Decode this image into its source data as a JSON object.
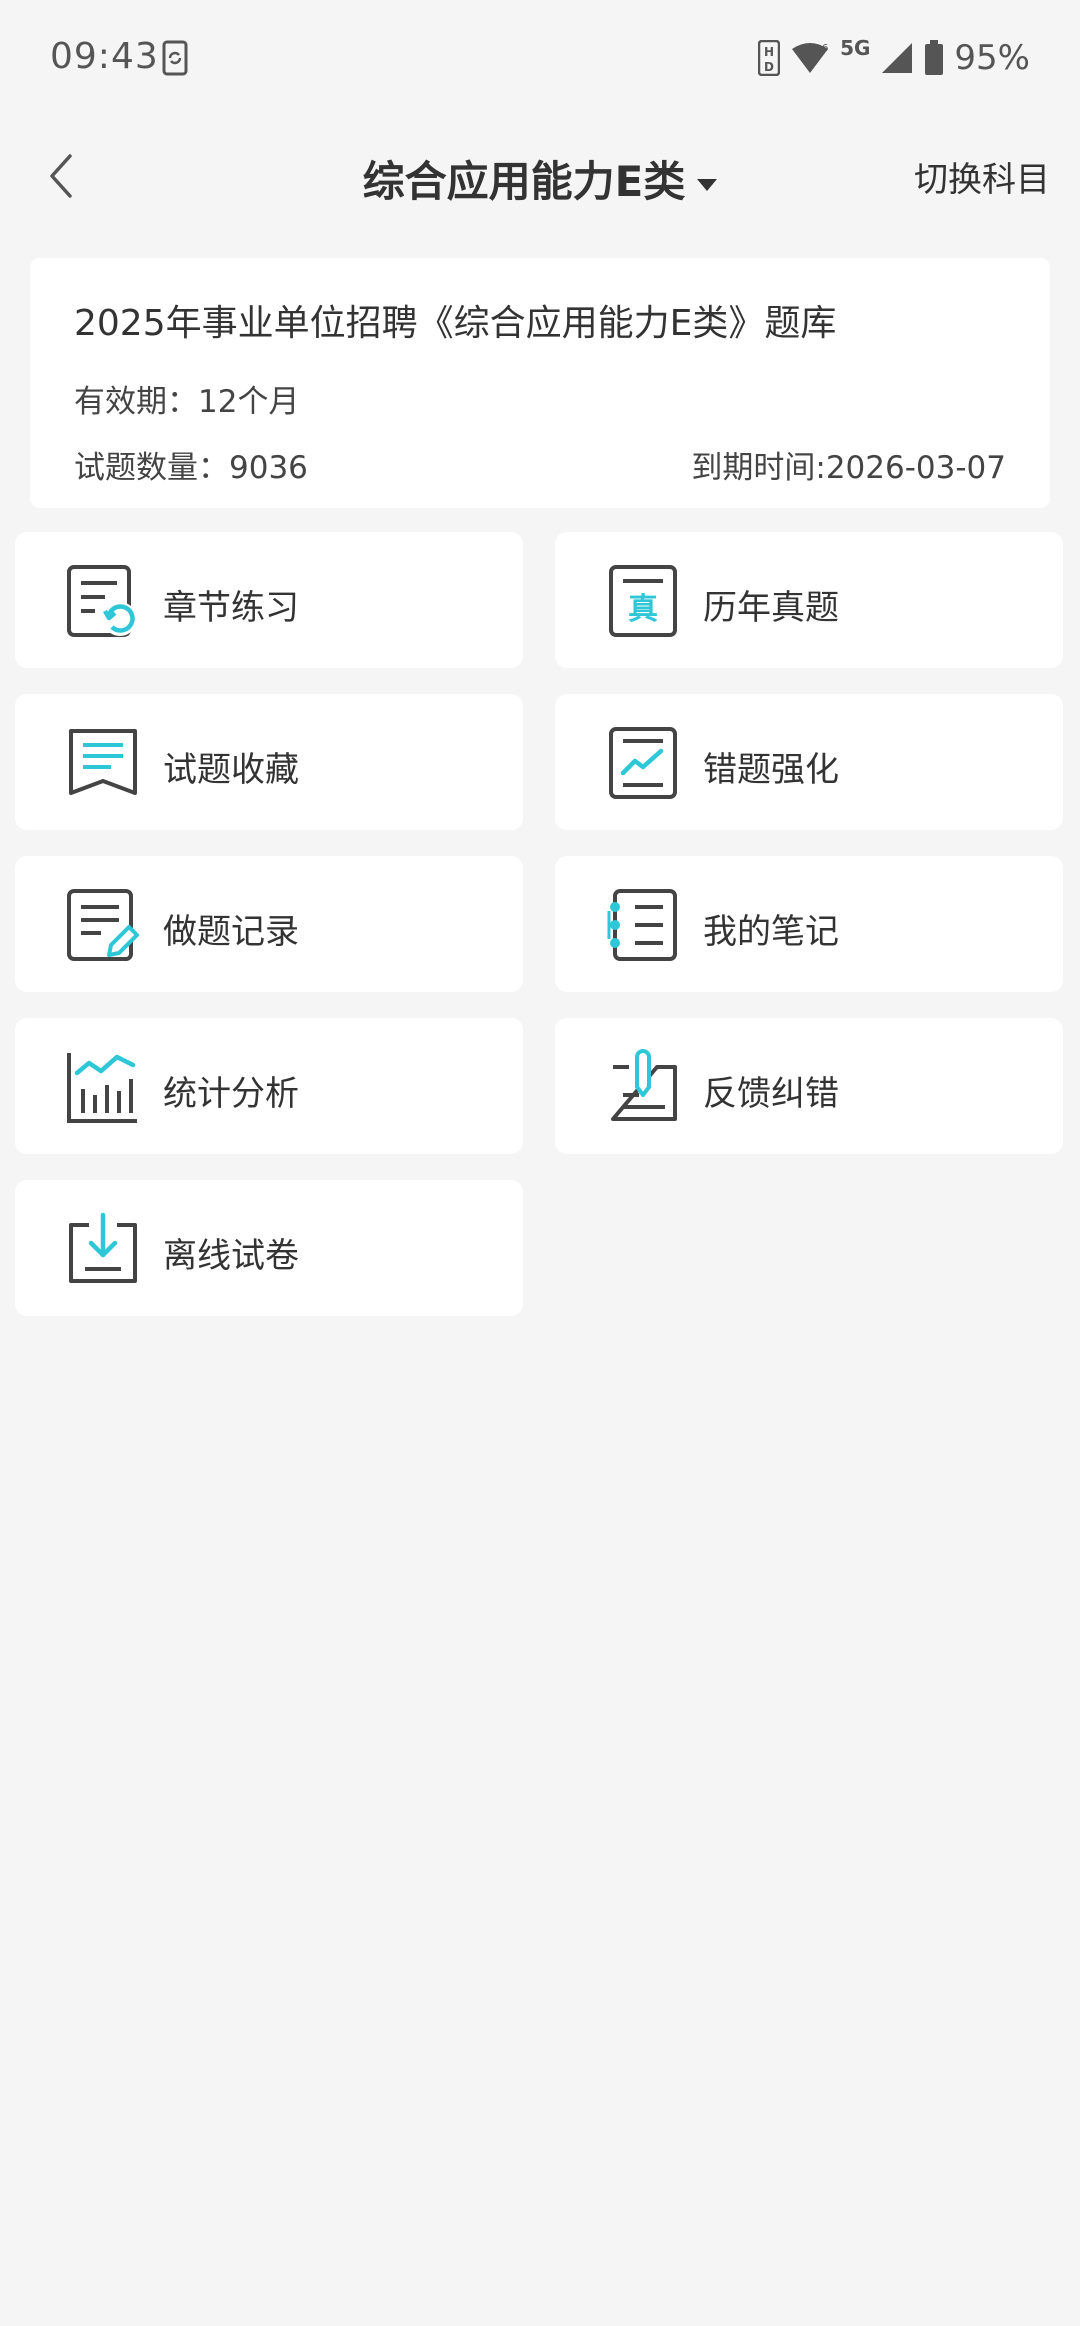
{
  "status_bar": {
    "time": "09:43",
    "network": "5G",
    "battery": "95%"
  },
  "header": {
    "title": "综合应用能力E类",
    "switch_label": "切换科目"
  },
  "info": {
    "title": "2025年事业单位招聘《综合应用能力E类》题库",
    "validity": "有效期：12个月",
    "count": "试题数量：9036",
    "expire": "到期时间:2026-03-07"
  },
  "menu": [
    {
      "label": "章节练习",
      "icon": "chapter-practice-icon"
    },
    {
      "label": "历年真题",
      "icon": "past-exam-icon"
    },
    {
      "label": "试题收藏",
      "icon": "bookmark-icon"
    },
    {
      "label": "错题强化",
      "icon": "mistake-chart-icon"
    },
    {
      "label": "做题记录",
      "icon": "record-edit-icon"
    },
    {
      "label": "我的笔记",
      "icon": "notebook-icon"
    },
    {
      "label": "统计分析",
      "icon": "bar-chart-icon"
    },
    {
      "label": "反馈纠错",
      "icon": "feedback-pen-icon"
    },
    {
      "label": "离线试卷",
      "icon": "download-icon"
    }
  ],
  "colors": {
    "accent": "#2ec7d8",
    "icon_stroke": "#444444",
    "background": "#f5f5f5",
    "card": "#ffffff"
  }
}
